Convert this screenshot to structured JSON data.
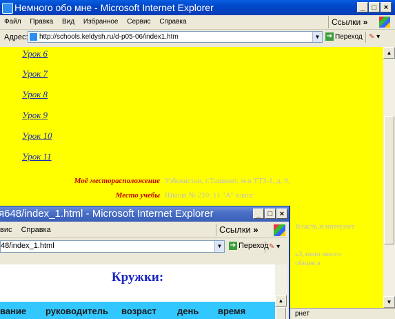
{
  "window1": {
    "title": "Немного обо мне - Microsoft Internet Explorer",
    "menu": [
      "Файл",
      "Правка",
      "Вид",
      "Избранное",
      "Сервис",
      "Справка"
    ],
    "links_label": "Ссылки",
    "chevron": "»",
    "address_label": "Адрес:",
    "url": "http://schools.keldysh.ru/d-p05-06/index1.htm",
    "go_label": "Переход",
    "lessons": [
      "Урок 6",
      "Урок 7",
      "Урок 8",
      "Урок 9",
      "Урок 10",
      "Урок 11"
    ],
    "info": [
      {
        "label": "Моё месторасположение",
        "value": "Узбекистан, г.Ташкент, м-в ТТЗ-1, д. 9,"
      },
      {
        "label": "Место учебы",
        "value": "Школа № 210; 11 \"А\" класс"
      }
    ],
    "partial_text": [
      "Власть,и интернет",
      "ь3,знаю много",
      "общеe,я"
    ],
    "status_text": "рнет",
    "background_color": "#ffff00"
  },
  "window2": {
    "title": "я648/index_1.html - Microsoft Internet Explorer",
    "menu": [
      "вис",
      "Справка"
    ],
    "links_label": "Ссылки",
    "chevron": "»",
    "url_partial": "48/index_1.html",
    "go_label": "Переход",
    "heading": "Кружки:",
    "table_headers": [
      "вание",
      "руководитель",
      "возраст",
      "день",
      "время"
    ],
    "header_color": "#32c8ff"
  }
}
